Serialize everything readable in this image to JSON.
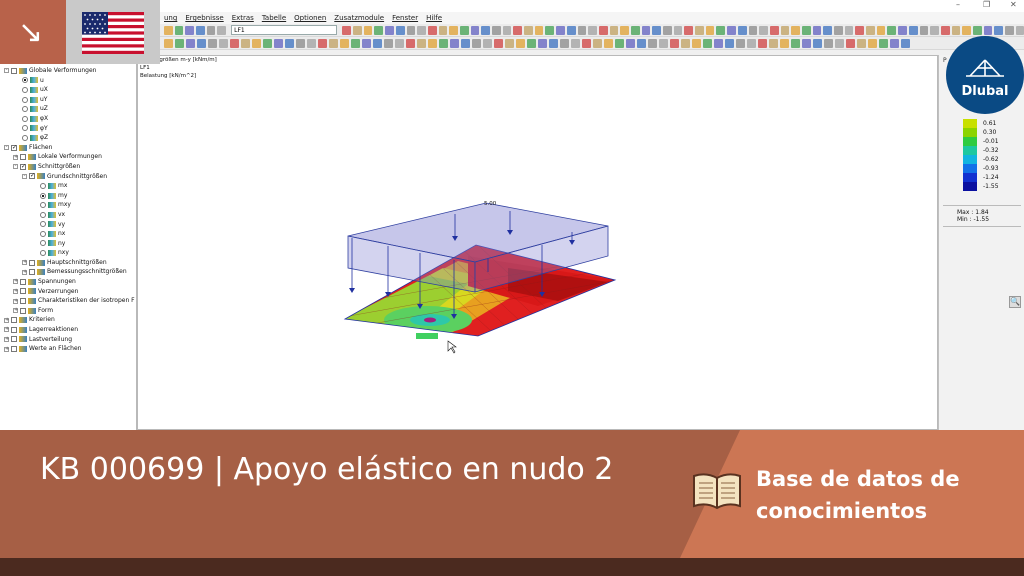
{
  "menubar": {
    "items": [
      "ung",
      "Ergebnisse",
      "Extras",
      "Tabelle",
      "Optionen",
      "Zusatzmodule",
      "Fenster",
      "Hilfe"
    ]
  },
  "toolbar": {
    "loadcase": "LF1"
  },
  "tree": {
    "items": [
      {
        "label": "Globale Verformungen",
        "level": 0,
        "type": "chk",
        "on": false,
        "exp": "-"
      },
      {
        "label": "u",
        "level": 2,
        "type": "rad",
        "on": true
      },
      {
        "label": "uX",
        "level": 2,
        "type": "rad",
        "on": false
      },
      {
        "label": "uY",
        "level": 2,
        "type": "rad",
        "on": false
      },
      {
        "label": "uZ",
        "level": 2,
        "type": "rad",
        "on": false
      },
      {
        "label": "φX",
        "level": 2,
        "type": "rad",
        "on": false
      },
      {
        "label": "φY",
        "level": 2,
        "type": "rad",
        "on": false
      },
      {
        "label": "φZ",
        "level": 2,
        "type": "rad",
        "on": false
      },
      {
        "label": "Flächen",
        "level": 0,
        "type": "chk",
        "on": true,
        "exp": "-"
      },
      {
        "label": "Lokale Verformungen",
        "level": 1,
        "type": "chk",
        "on": false,
        "exp": "+"
      },
      {
        "label": "Schnittgrößen",
        "level": 1,
        "type": "chk",
        "on": true,
        "exp": "-"
      },
      {
        "label": "Grundschnittgrößen",
        "level": 2,
        "type": "chk",
        "on": true,
        "exp": "-"
      },
      {
        "label": "mx",
        "level": 4,
        "type": "rad",
        "on": false
      },
      {
        "label": "my",
        "level": 4,
        "type": "rad",
        "on": true
      },
      {
        "label": "mxy",
        "level": 4,
        "type": "rad",
        "on": false
      },
      {
        "label": "vx",
        "level": 4,
        "type": "rad",
        "on": false
      },
      {
        "label": "vy",
        "level": 4,
        "type": "rad",
        "on": false
      },
      {
        "label": "nx",
        "level": 4,
        "type": "rad",
        "on": false
      },
      {
        "label": "ny",
        "level": 4,
        "type": "rad",
        "on": false
      },
      {
        "label": "nxy",
        "level": 4,
        "type": "rad",
        "on": false
      },
      {
        "label": "Hauptschnittgrößen",
        "level": 2,
        "type": "chk",
        "on": false,
        "exp": "+"
      },
      {
        "label": "Bemessungsschnittgrößen",
        "level": 2,
        "type": "chk",
        "on": false,
        "exp": "+"
      },
      {
        "label": "Spannungen",
        "level": 1,
        "type": "chk",
        "on": false,
        "exp": "+"
      },
      {
        "label": "Verzerrungen",
        "level": 1,
        "type": "chk",
        "on": false,
        "exp": "+"
      },
      {
        "label": "Charakteristiken der isotropen F",
        "level": 1,
        "type": "chk",
        "on": false,
        "exp": "+"
      },
      {
        "label": "Form",
        "level": 1,
        "type": "chk",
        "on": false,
        "exp": "+"
      },
      {
        "label": "Kriterien",
        "level": 0,
        "type": "chk",
        "on": false,
        "exp": "+"
      },
      {
        "label": "Lagerreaktionen",
        "level": 0,
        "type": "chk",
        "on": false,
        "exp": "+"
      },
      {
        "label": "Lastverteilung",
        "level": 0,
        "type": "chk",
        "on": false,
        "exp": "+"
      },
      {
        "label": "Werte an Flächen",
        "level": 0,
        "type": "chk",
        "on": false,
        "exp": "+"
      }
    ]
  },
  "viewport": {
    "line1": "Schnittgrößen m-y [kNm/m]",
    "line2": "LF1",
    "line3": "Belastung [kN/m^2]",
    "load_value": "5.00"
  },
  "legend": {
    "header_initial": "P",
    "rows": [
      {
        "value": "0.61",
        "color": "#c8e000"
      },
      {
        "value": "0.30",
        "color": "#8cd400"
      },
      {
        "value": "-0.01",
        "color": "#2ecc40"
      },
      {
        "value": "-0.32",
        "color": "#1cc8a0"
      },
      {
        "value": "-0.62",
        "color": "#10b4e0"
      },
      {
        "value": "-0.93",
        "color": "#1070e8"
      },
      {
        "value": "-1.24",
        "color": "#1030d0"
      },
      {
        "value": "-1.55",
        "color": "#0a10a0"
      }
    ],
    "max_label": "Max :",
    "max_value": "1.84",
    "min_label": "Min :",
    "min_value": "-1.55"
  },
  "logo": {
    "text": "Dlubal"
  },
  "banner": {
    "title": "KB 000699 | Apoyo elástico en nudo 2",
    "subtitle": "Base de datos de conocimientos"
  },
  "colors": {
    "banner_left": "#a65f45",
    "banner_right": "#cc7654",
    "brand": "#b8624a",
    "logo": "#0a4a84"
  }
}
